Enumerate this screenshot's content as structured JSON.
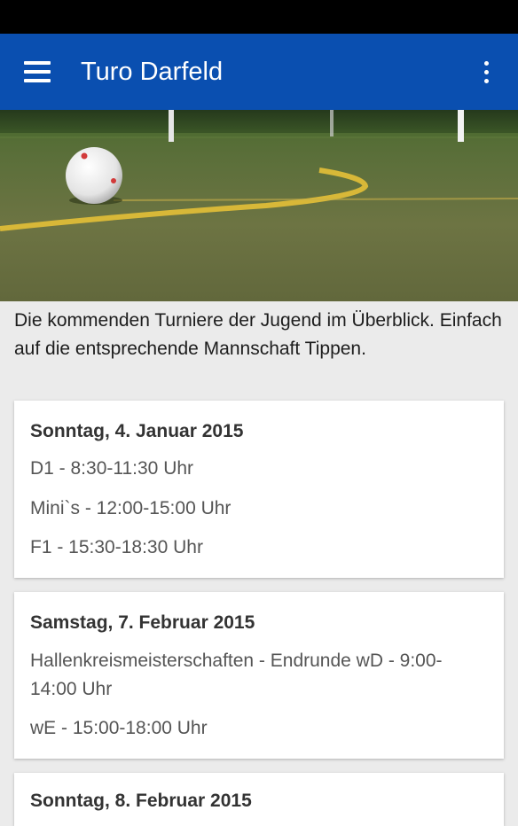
{
  "app": {
    "title": "Turo Darfeld"
  },
  "intro": "Die kommenden Turniere der Jugend im Überblick. Einfach auf die entsprechende Mannschaft Tippen.",
  "cards": [
    {
      "date": "Sonntag, 4. Januar 2015",
      "events": [
        "D1 - 8:30-11:30 Uhr",
        "Mini`s - 12:00-15:00 Uhr",
        "F1 - 15:30-18:30 Uhr"
      ]
    },
    {
      "date": "Samstag, 7. Februar 2015",
      "events": [
        "Hallenkreismeisterschaften - Endrunde wD - 9:00-14:00 Uhr",
        "wE - 15:00-18:00 Uhr"
      ]
    },
    {
      "date": "Sonntag, 8. Februar 2015",
      "events": []
    }
  ],
  "colors": {
    "appbar": "#0a4fb0",
    "background": "#ebebeb",
    "card": "#ffffff"
  },
  "icons": {
    "menu": "hamburger-menu-icon",
    "overflow": "more-vert-icon"
  }
}
